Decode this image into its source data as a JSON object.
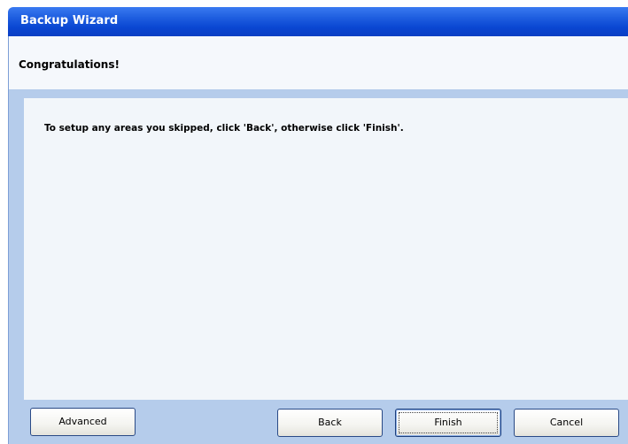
{
  "window": {
    "title": "Backup Wizard"
  },
  "header": {
    "title": "Congratulations!"
  },
  "body": {
    "message": "To setup any areas you skipped, click 'Back', otherwise click 'Finish'."
  },
  "buttons": {
    "advanced": "Advanced",
    "back": "Back",
    "finish": "Finish",
    "cancel": "Cancel"
  },
  "colors": {
    "titlebar": "#0a46d2",
    "panel_background": "#f2f6fa",
    "frame_background": "#b5cceb"
  }
}
